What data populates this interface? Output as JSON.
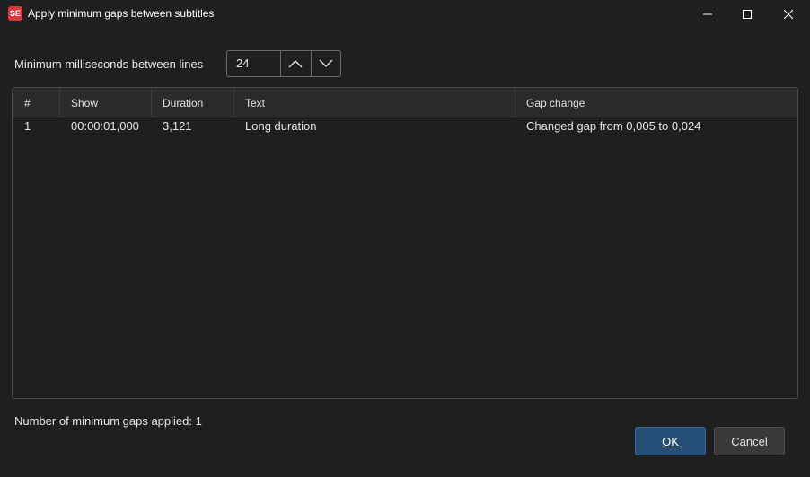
{
  "window": {
    "title": "Apply minimum gaps between subtitles",
    "icon_text": "SE",
    "controls": {
      "minimize": "minimize-icon",
      "maximize": "maximize-icon",
      "close": "close-icon"
    }
  },
  "settings": {
    "label": "Minimum milliseconds between lines",
    "value": "24"
  },
  "table": {
    "columns": [
      "#",
      "Show",
      "Duration",
      "Text",
      "Gap change"
    ],
    "rows": [
      {
        "num": "1",
        "show": "00:00:01,000",
        "duration": "3,121",
        "text": "Long duration",
        "gap_change": "Changed gap from 0,005 to 0,024"
      }
    ]
  },
  "status": "Number of minimum gaps applied: 1",
  "buttons": {
    "ok": "OK",
    "cancel": "Cancel"
  },
  "colors": {
    "background": "#1f1f1f",
    "accent_button": "#264f78",
    "app_icon": "#d9363e"
  }
}
